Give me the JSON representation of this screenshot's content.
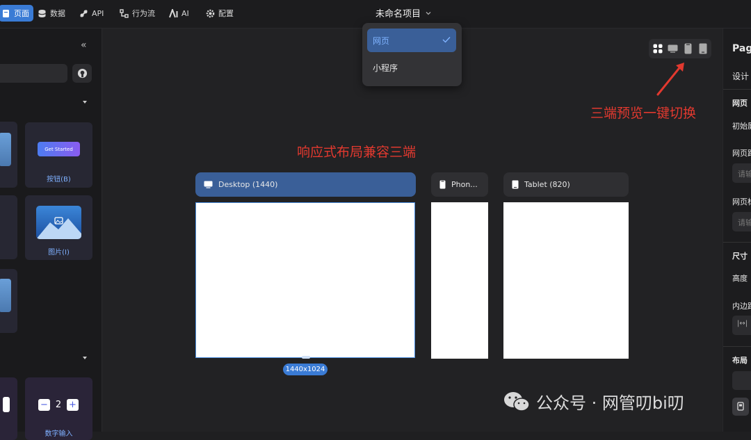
{
  "topnav": {
    "items": [
      {
        "label": "页面",
        "icon": "page-icon"
      },
      {
        "label": "数据",
        "icon": "database-icon"
      },
      {
        "label": "API",
        "icon": "api-icon"
      },
      {
        "label": "行为流",
        "icon": "flow-icon"
      },
      {
        "label": "AI",
        "icon": "ai-icon"
      },
      {
        "label": "配置",
        "icon": "gear-icon"
      }
    ],
    "project_title": "未命名项目"
  },
  "dropdown": {
    "items": [
      {
        "label": "网页",
        "selected": true
      },
      {
        "label": "小程序",
        "selected": false
      }
    ]
  },
  "left_panel": {
    "collapse_glyph": "«",
    "button_card": {
      "preview_text": "Get Started",
      "label": "按钮(B)"
    },
    "image_card": {
      "label": "图片(I)"
    },
    "stepper_card": {
      "value": "2",
      "label": "数字输入"
    }
  },
  "canvas": {
    "tabs": [
      {
        "label": "Desktop (1440)",
        "icon": "desktop-icon"
      },
      {
        "label": "Phon...",
        "icon": "phone-icon"
      },
      {
        "label": "Tablet (820)",
        "icon": "tablet-icon"
      }
    ],
    "size_badge": "1440x1024",
    "annotation_layout": "响应式布局兼容三端",
    "annotation_switch": "三端预览一键切换"
  },
  "right_panel": {
    "title": "Page",
    "tab": "设计",
    "section_page": "网页",
    "label_initial": "初始屏",
    "label_path": "网页路",
    "placeholder_1": "请输",
    "label_title": "网页标",
    "placeholder_2": "请输",
    "section_size": "尺寸",
    "label_height": "高度",
    "label_padding": "内边距",
    "section_layout": "布局"
  },
  "watermark": "公众号 · 网管叨bi叨",
  "colors": {
    "accent": "#3a7bd5",
    "annotation": "#e2392f"
  }
}
